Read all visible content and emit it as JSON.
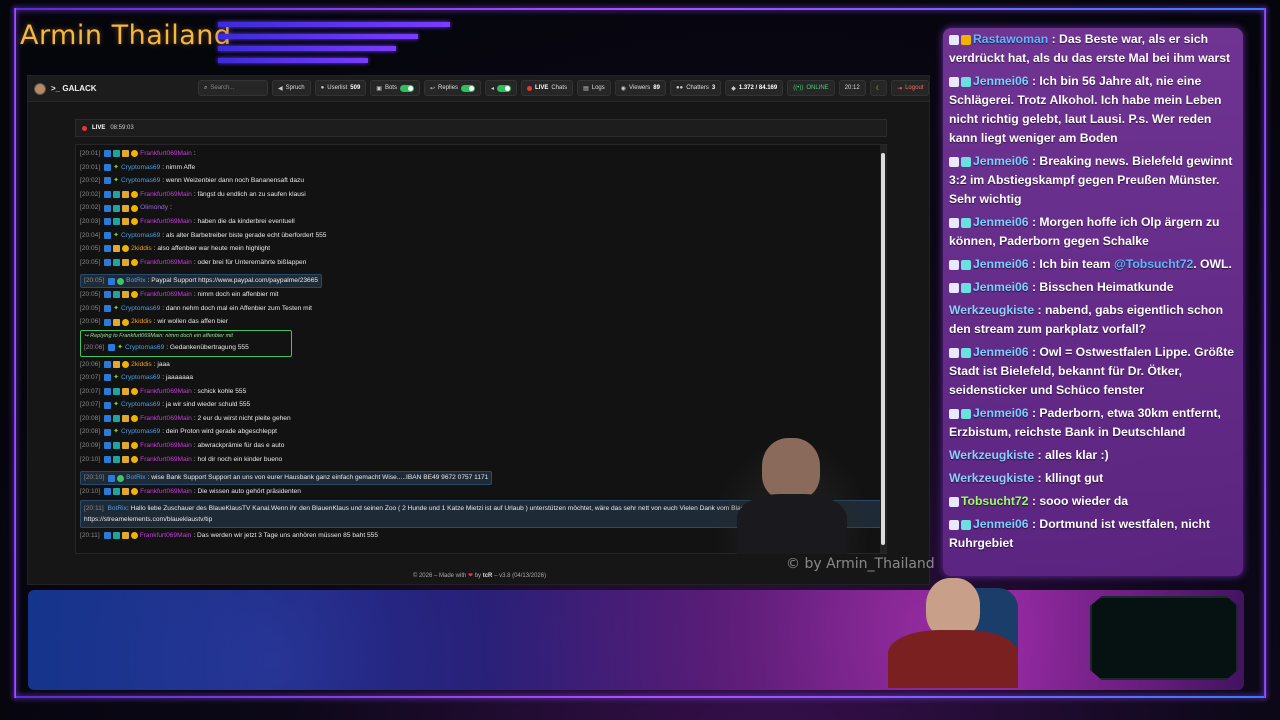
{
  "stream": {
    "title": "Armin Thailand",
    "watermark": "© by Armin_Thailand"
  },
  "navbar": {
    "brand": ">_ GALACK",
    "search_placeholder": "Search...",
    "spruch": "Spruch",
    "userlist_label": "Userlist",
    "userlist_count": "509",
    "bots": "Bots",
    "replies": "Replies",
    "live_label": "LIVE",
    "live_sub": "Chats",
    "logs": "Logs",
    "viewers_label": "Viewers",
    "viewers_count": "89",
    "chatters_label": "Chatters",
    "chatters_count": "3",
    "messages_count": "1.372 / 84.169",
    "online": "ONLINE",
    "time": "20:12",
    "logout": "Logout"
  },
  "live_banner": {
    "label": "LIVE",
    "duration": "08:59:03"
  },
  "chat": [
    {
      "ts": "[20:01]",
      "user": "Frankfurt069Main",
      "color": "magenta",
      "text": ":",
      "badges": "main"
    },
    {
      "ts": "[20:01]",
      "user": "Cryptomas69",
      "color": "blue",
      "text": ": nimm Affe",
      "badges": "crypto"
    },
    {
      "ts": "[20:02]",
      "user": "Cryptomas69",
      "color": "blue",
      "text": ": wenn Weizenbier dann noch Bananensaft dazu",
      "badges": "crypto"
    },
    {
      "ts": "[20:02]",
      "user": "Frankfurt069Main",
      "color": "magenta",
      "text": ": fängst du endlich an zu saufen klausi",
      "badges": "main"
    },
    {
      "ts": "[20:02]",
      "user": "Olimondy",
      "color": "purple",
      "text": ":",
      "badges": "oli"
    },
    {
      "ts": "[20:03]",
      "user": "Frankfurt069Main",
      "color": "magenta",
      "text": ": haben die da kinderbrei eventuell",
      "badges": "main"
    },
    {
      "ts": "[20:04]",
      "user": "Cryptomas69",
      "color": "blue",
      "text": ": als alter Barbetreiber biste gerade echt überfordert 555",
      "badges": "crypto"
    },
    {
      "ts": "[20:05]",
      "user": "2kiddis",
      "color": "orange",
      "text": ": also affenbier war heute mein highlight",
      "badges": "kid"
    },
    {
      "ts": "[20:05]",
      "user": "Frankfurt069Main",
      "color": "magenta",
      "text": ": oder brei für Unterernährte bißlappen",
      "badges": "main"
    }
  ],
  "bot1": {
    "ts": "[20:05]",
    "user": "BotRix",
    "text": ": Paypal Support https://www.paypal.com/paypalme/23665"
  },
  "chat2": [
    {
      "ts": "[20:05]",
      "user": "Frankfurt069Main",
      "color": "magenta",
      "text": ": nimm doch ein affenbier mit",
      "badges": "main"
    },
    {
      "ts": "[20:05]",
      "user": "Cryptomas69",
      "color": "blue",
      "text": ": dann nehm doch mal ein Affenbier zum Testen mit",
      "badges": "crypto"
    },
    {
      "ts": "[20:06]",
      "user": "2kiddis",
      "color": "orange",
      "text": ": wir wollen das affen bier",
      "badges": "kid"
    }
  ],
  "reply": {
    "head": "Replying to Frankfurt069Main: nimm doch ein affenbier mit",
    "ts": "[20:06]",
    "user": "Cryptomas69",
    "text": ": Gedankenübertragung 555"
  },
  "chat3": [
    {
      "ts": "[20:06]",
      "user": "2kiddis",
      "color": "orange",
      "text": ": jaaa",
      "badges": "kid"
    },
    {
      "ts": "[20:07]",
      "user": "Cryptomas69",
      "color": "blue",
      "text": ": jaaaaaaa",
      "badges": "crypto"
    },
    {
      "ts": "[20:07]",
      "user": "Frankfurt069Main",
      "color": "magenta",
      "text": ": schick kohle 555",
      "badges": "main"
    },
    {
      "ts": "[20:07]",
      "user": "Cryptomas69",
      "color": "blue",
      "text": ": ja wir sind wieder schuld 555",
      "badges": "crypto"
    },
    {
      "ts": "[20:08]",
      "user": "Frankfurt069Main",
      "color": "magenta",
      "text": ": 2 eur du wirst nicht pleite gehen",
      "badges": "main"
    },
    {
      "ts": "[20:08]",
      "user": "Cryptomas69",
      "color": "blue",
      "text": ": dein Proton wird gerade abgeschleppt",
      "badges": "crypto"
    },
    {
      "ts": "[20:09]",
      "user": "Frankfurt069Main",
      "color": "magenta",
      "text": ": abwrackprämie für das e auto",
      "badges": "main"
    },
    {
      "ts": "[20:10]",
      "user": "Frankfurt069Main",
      "color": "magenta",
      "text": ": hol dir noch ein kinder bueno",
      "badges": "main"
    }
  ],
  "bot2": {
    "ts": "[20:10]",
    "user": "BotRix",
    "text": ": wise Bank Support Support an uns von eurer Hausbank ganz einfach gemacht Wise.....IBAN BE49 9672 0757 1171"
  },
  "chat4": {
    "ts": "[20:10]",
    "user": "Frankfurt069Main",
    "text": ": Die wissen auto gehört präsidenten"
  },
  "bot3": {
    "ts": "[20:11]",
    "user": "BotRix",
    "text": ": Hallo liebe Zuschauer des BlaueKlausTV Kanal.Wenn ihr den BlauenKlaus und seinen Zoo ( 2 Hunde und 1 Katze Mietzi ist auf Urlaub ) unterstützen möchtet, wäre das sehr nett von euch Vielen Dank vom BlauenKlaus https://streamelements.com/blaueklaustv/tip"
  },
  "chat5": {
    "ts": "[20:11]",
    "user": "Frankfurt069Main",
    "text": ": Das werden wir jetzt 3 Tage uns anhören müssen 85 baht 555"
  },
  "footer": {
    "left": "© 2026 – Made with",
    "mid": "by",
    "author": "tcR",
    "version": "– v3.8 (04/13/2026)"
  },
  "overlay": [
    {
      "user": "Rastawoman",
      "color": "blue",
      "text": ": Das Beste war, als er sich verdrückt hat, als du das erste Mal bei ihm warst"
    },
    {
      "user": "Jenmei06",
      "color": "teal",
      "text": ": Ich bin 56 Jahre alt, nie eine Schlägerei. Trotz Alkohol. Ich habe mein Leben nicht richtig gelebt, laut Lausi. P.s. Wer reden kann liegt weniger am Boden"
    },
    {
      "user": "Jenmei06",
      "color": "teal",
      "text": ": Breaking news. Bielefeld gewinnt 3:2 im Abstiegskampf gegen Preußen Münster. Sehr wichtig"
    },
    {
      "user": "Jenmei06",
      "color": "teal",
      "text": ": Morgen hoffe ich Olp ärgern zu können, Paderborn gegen Schalke"
    },
    {
      "user": "Jenmei06",
      "color": "teal",
      "text": ": Ich bin team",
      "mention": "@Tobsucht72",
      "tail": ". OWL."
    },
    {
      "user": "Jenmei06",
      "color": "teal",
      "text": ": Bisschen Heimatkunde"
    },
    {
      "user": "Werkzeugkiste",
      "color": "light",
      "text": ": nabend, gabs eigentlich schon den stream zum parkplatz vorfall?"
    },
    {
      "user": "Jenmei06",
      "color": "teal",
      "text": ": Owl = Ostwestfalen Lippe. Größte Stadt ist Bielefeld, bekannt für Dr. Ötker, seidensticker und Schüco fenster"
    },
    {
      "user": "Jenmei06",
      "color": "teal",
      "text": ": Paderborn, etwa 30km entfernt, Erzbistum, reichste Bank in Deutschland"
    },
    {
      "user": "Werkzeugkiste",
      "color": "light",
      "text": ": alles klar :)"
    },
    {
      "user": "Werkzeugkiste",
      "color": "light",
      "text": ": kllingt gut"
    },
    {
      "user": "Tobsucht72",
      "color": "green",
      "text": ": sooo wieder da"
    },
    {
      "user": "Jenmei06",
      "color": "teal",
      "text": ": Dortmund ist westfalen, nicht Ruhrgebiet"
    }
  ]
}
